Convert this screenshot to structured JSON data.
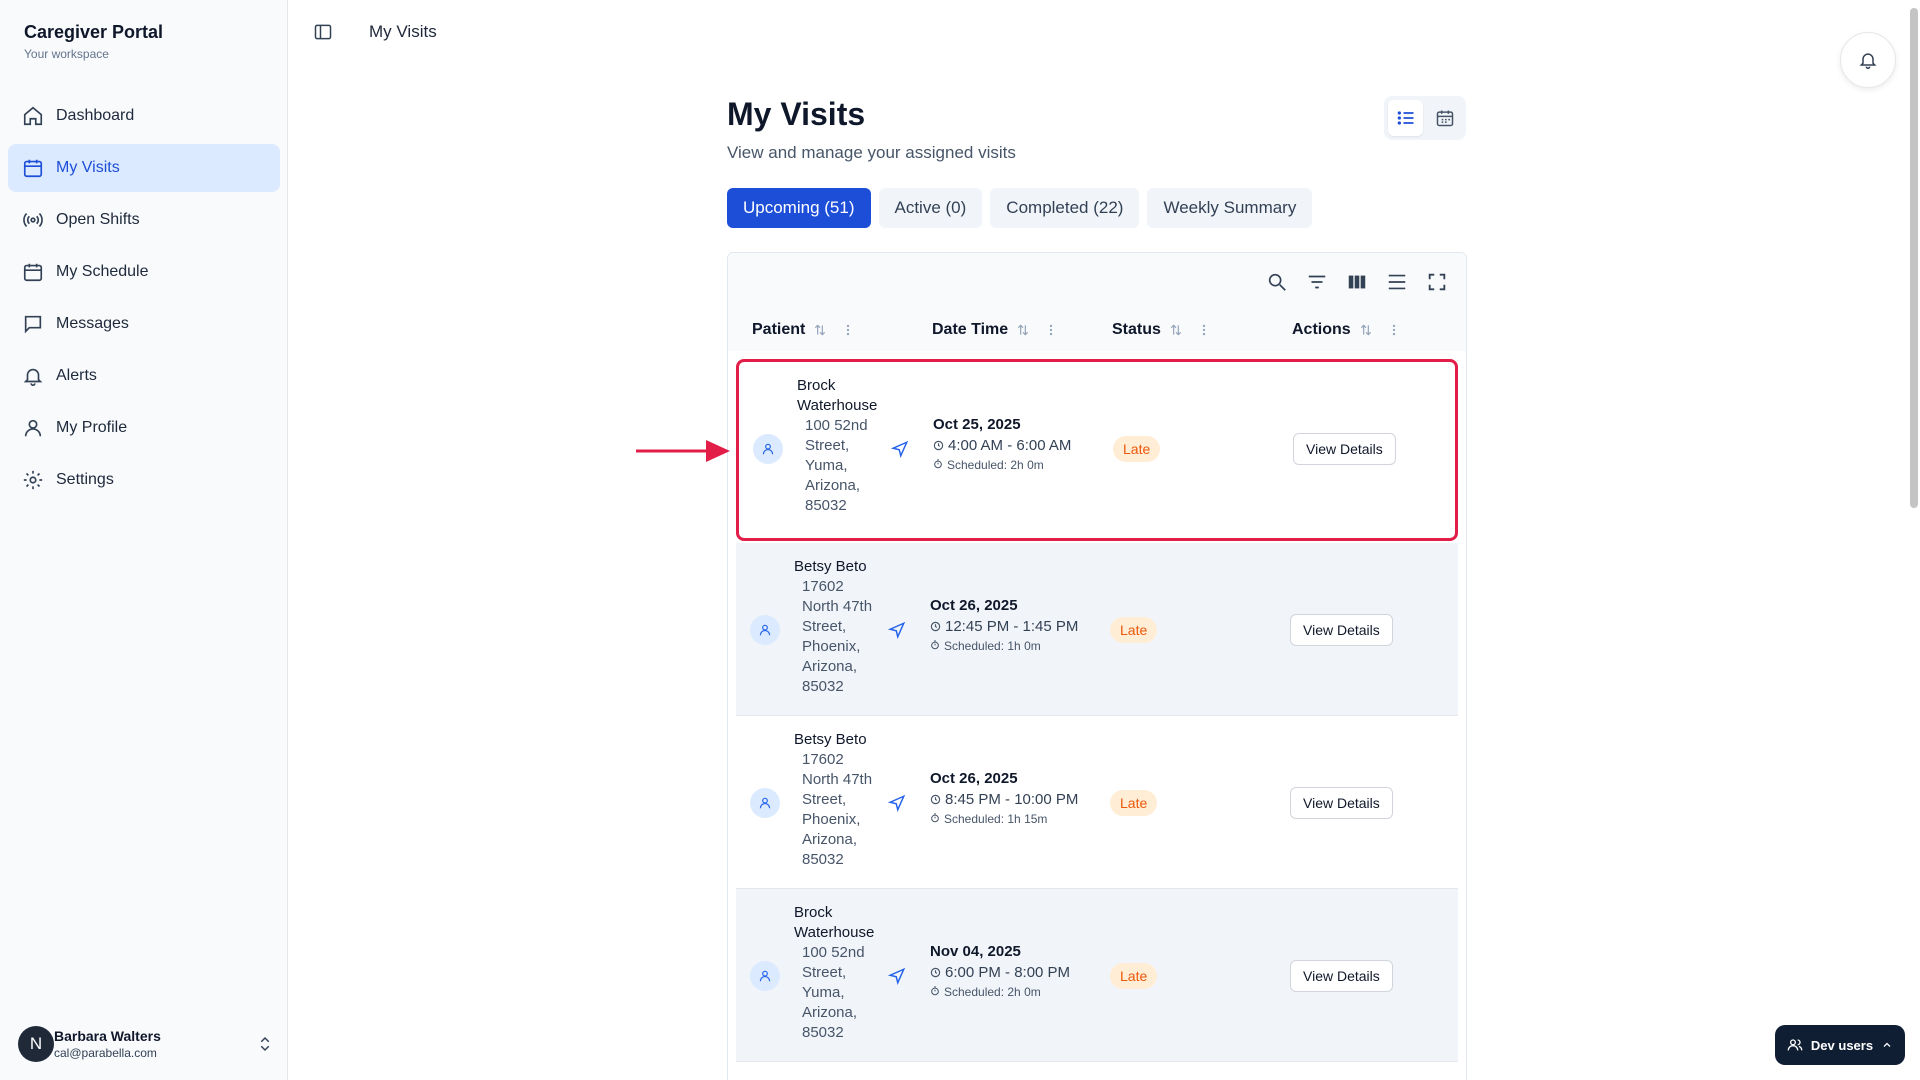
{
  "brand": {
    "title": "Caregiver Portal",
    "subtitle": "Your workspace"
  },
  "sidebar": {
    "items": [
      {
        "label": "Dashboard",
        "icon": "home-icon"
      },
      {
        "label": "My Visits",
        "icon": "calendar-icon",
        "active": true
      },
      {
        "label": "Open Shifts",
        "icon": "broadcast-icon"
      },
      {
        "label": "My Schedule",
        "icon": "calendar-icon"
      },
      {
        "label": "Messages",
        "icon": "message-icon"
      },
      {
        "label": "Alerts",
        "icon": "bell-icon"
      },
      {
        "label": "My Profile",
        "icon": "user-icon"
      },
      {
        "label": "Settings",
        "icon": "gear-icon"
      }
    ]
  },
  "user": {
    "initial": "N",
    "name": "Barbara Walters",
    "email": "cal@parabella.com"
  },
  "header": {
    "breadcrumb": "My Visits"
  },
  "page": {
    "title": "My Visits",
    "subtitle": "View and manage your assigned visits"
  },
  "tabs": [
    {
      "label": "Upcoming (51)",
      "active": true
    },
    {
      "label": "Active (0)"
    },
    {
      "label": "Completed (22)"
    },
    {
      "label": "Weekly Summary"
    }
  ],
  "table": {
    "columns": [
      "Patient",
      "Date Time",
      "Status",
      "Actions"
    ],
    "rows": [
      {
        "name": [
          "Brock",
          "Waterhouse"
        ],
        "address": [
          "100 52nd",
          "Street,",
          "Yuma,",
          "Arizona,",
          "85032"
        ],
        "date": "Oct 25, 2025",
        "time": "4:00 AM - 6:00 AM",
        "scheduled": "Scheduled: 2h 0m",
        "status": "Late",
        "action": "View Details"
      },
      {
        "name": [
          "Betsy Beto"
        ],
        "address": [
          "17602",
          "North 47th",
          "Street,",
          "Phoenix,",
          "Arizona,",
          "85032"
        ],
        "date": "Oct 26, 2025",
        "time": "12:45 PM - 1:45 PM",
        "scheduled": "Scheduled: 1h 0m",
        "status": "Late",
        "action": "View Details"
      },
      {
        "name": [
          "Betsy Beto"
        ],
        "address": [
          "17602",
          "North 47th",
          "Street,",
          "Phoenix,",
          "Arizona,",
          "85032"
        ],
        "date": "Oct 26, 2025",
        "time": "8:45 PM - 10:00 PM",
        "scheduled": "Scheduled: 1h 15m",
        "status": "Late",
        "action": "View Details"
      },
      {
        "name": [
          "Brock",
          "Waterhouse"
        ],
        "address": [
          "100 52nd",
          "Street,",
          "Yuma,",
          "Arizona,",
          "85032"
        ],
        "date": "Nov 04, 2025",
        "time": "6:00 PM - 8:00 PM",
        "scheduled": "Scheduled: 2h 0m",
        "status": "Late",
        "action": "View Details"
      }
    ]
  },
  "dev_button": {
    "label": "Dev users"
  },
  "colors": {
    "accent": "#1d4ed8",
    "late_text": "#ea580c",
    "late_bg": "#ffedd5",
    "highlight": "#e11d48"
  }
}
